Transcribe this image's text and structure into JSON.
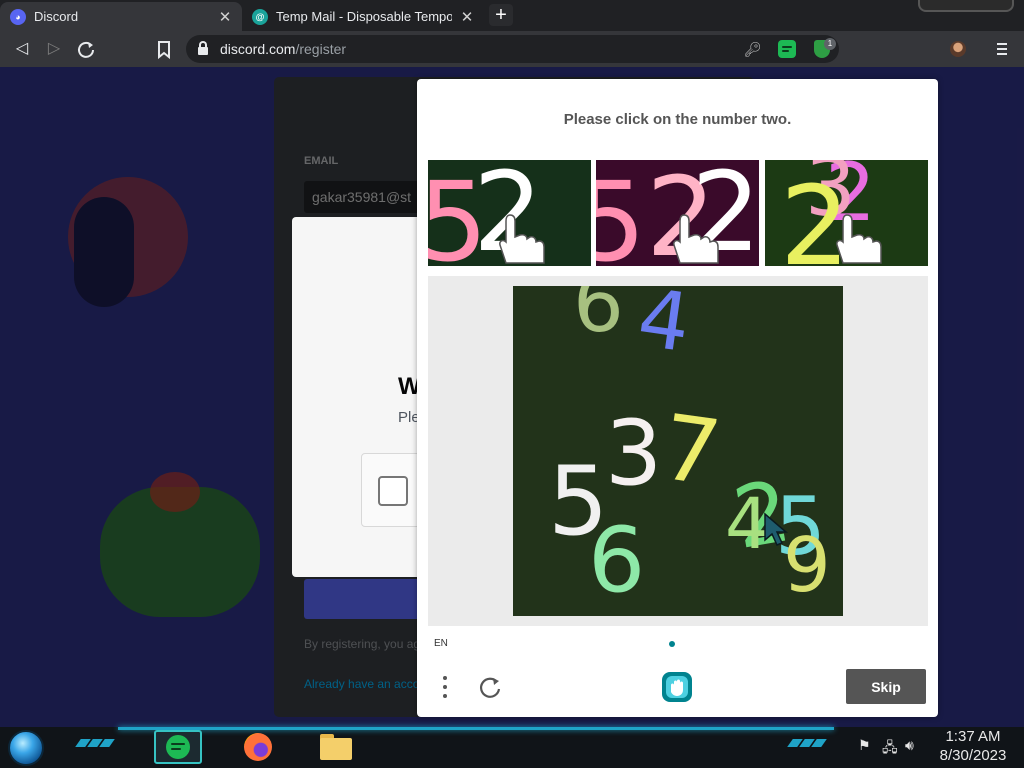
{
  "browser": {
    "tabs": [
      {
        "title": "Discord",
        "close": "✕",
        "active": true
      },
      {
        "title": "Temp Mail - Disposable Temporary",
        "close": "✕",
        "active": false
      }
    ],
    "new_tab": "+",
    "url_domain": "discord.com",
    "url_path": "/register",
    "extension_badge": "1"
  },
  "discord_page": {
    "email_label": "EMAIL",
    "email_value": "gakar35981@st",
    "verify_title": "W",
    "verify_subtitle": "Ple",
    "registration_note": "By registering, you agree",
    "login_link": "Already have an account?"
  },
  "captcha": {
    "prompt": "Please click on the number two.",
    "language": "EN",
    "skip_label": "Skip",
    "examples": [
      {
        "digits": [
          "5",
          "2"
        ],
        "bg": "#15301a",
        "colors": [
          "#ff8fb1",
          "#ffffff"
        ]
      },
      {
        "digits": [
          "5",
          "2",
          "2"
        ],
        "bg": "#3a0a2a",
        "colors": [
          "#ff8fb1",
          "#ffb3c6",
          "#ffffff"
        ]
      },
      {
        "digits": [
          "2",
          "3",
          "2"
        ],
        "bg": "#1c3a14",
        "colors": [
          "#e86de0",
          "#f2a0c0",
          "#e8f060"
        ]
      }
    ],
    "main_image": {
      "bg": "#22331a",
      "digits": [
        {
          "char": "6",
          "color": "#a7c080"
        },
        {
          "char": "4",
          "color": "#6a7cf0"
        },
        {
          "char": "3",
          "color": "#f5f0f0"
        },
        {
          "char": "7",
          "color": "#ecec6a"
        },
        {
          "char": "5",
          "color": "#f0f0f0"
        },
        {
          "char": "6",
          "color": "#8ee8a8"
        },
        {
          "char": "2",
          "color": "#6ad87a"
        },
        {
          "char": "4",
          "color": "#a8e080"
        },
        {
          "char": "5",
          "color": "#70d8d8"
        },
        {
          "char": "9",
          "color": "#d8e070"
        }
      ]
    }
  },
  "taskbar": {
    "time": "1:37 AM",
    "date": "8/30/2023"
  },
  "colors": {
    "discord_bg": "#2d3080",
    "blurple": "#5865f2",
    "captcha_teal": "#00838f",
    "skip_bg": "#555555"
  }
}
